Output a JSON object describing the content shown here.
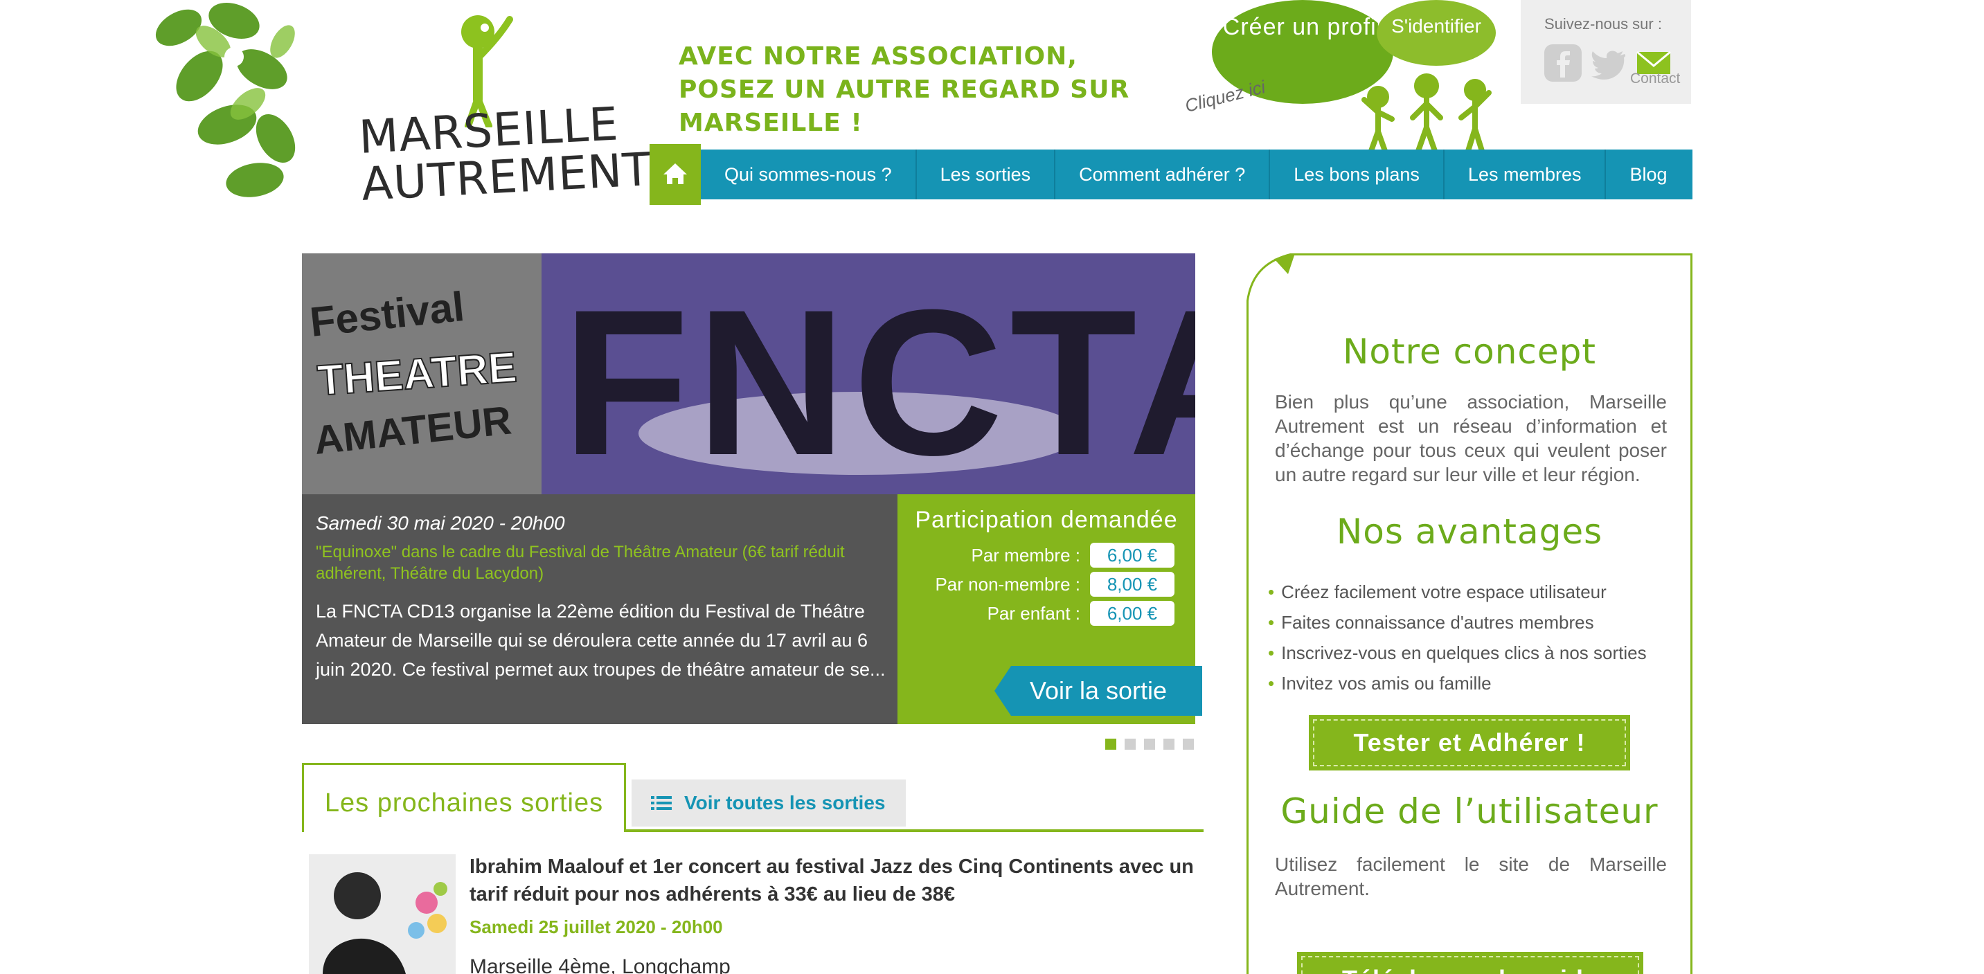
{
  "header": {
    "logo_line1": "MARSEILLE",
    "logo_line2": "AUTREMENT",
    "tagline_line1": "AVEC NOTRE ASSOCIATION,",
    "tagline_line2": "POSEZ UN AUTRE REGARD SUR MARSEILLE !",
    "create_profile": "Créer un profil",
    "login": "S'identifier",
    "click_here": "Cliquez ici",
    "follow_us": "Suivez-nous sur :",
    "contact": "Contact"
  },
  "nav": {
    "items": [
      {
        "label": "Qui sommes-nous ?"
      },
      {
        "label": "Les sorties"
      },
      {
        "label": "Comment adhérer ?"
      },
      {
        "label": "Les bons plans"
      },
      {
        "label": "Les membres"
      },
      {
        "label": "Blog"
      }
    ]
  },
  "slider": {
    "banner_title": "FNCTA",
    "poster_line1": "Festival",
    "poster_line2": "THEATRE",
    "poster_line3": "AMATEUR",
    "date": "Samedi 30 mai 2020 - 20h00",
    "subtitle": "\"Equinoxe\" dans le cadre du Festival de Théâtre Amateur (6€ tarif réduit adhérent, Théâtre du Lacydon)",
    "description": "La FNCTA CD13 organise la 22ème édition du Festival de Théâtre Amateur de Marseille qui se déroulera cette année du 17 avril au 6 juin 2020. Ce festival permet aux troupes de théâtre amateur de se...",
    "price_title": "Participation demandée",
    "prices": [
      {
        "label": "Par membre :",
        "value": "6,00 €"
      },
      {
        "label": "Par non-membre :",
        "value": "8,00 €"
      },
      {
        "label": "Par enfant :",
        "value": "6,00 €"
      }
    ],
    "cta": "Voir la sortie",
    "active_slide": 1,
    "slide_count": 5
  },
  "tabs": {
    "active": "Les prochaines sorties",
    "other": "Voir toutes les sorties"
  },
  "event": {
    "title": "Ibrahim Maalouf et 1er concert au festival Jazz des Cinq Continents avec un tarif réduit pour nos adhérents à 33€ au lieu de 38€",
    "date": "Samedi 25 juillet 2020 - 20h00",
    "location": "Marseille 4ème, Longchamp"
  },
  "sidebar": {
    "concept_title": "Notre concept",
    "concept_text": "Bien plus qu’une association, Marseille Autrement est un réseau d’information et d’échange pour tous ceux qui veulent poser un autre regard sur leur ville et leur région.",
    "advantages_title": "Nos avantages",
    "advantages": [
      "Créez facilement votre espace utilisateur",
      "Faites connaissance d'autres membres",
      "Inscrivez-vous en quelques clics à nos sorties",
      "Invitez vos amis ou famille"
    ],
    "test_button": "Tester et Adhérer !",
    "guide_title": "Guide de l’utilisateur",
    "guide_text": "Utilisez facilement le site de Marseille Autrement.",
    "download_button": "Télécharger le guide"
  },
  "colors": {
    "green": "#85b61c",
    "blue": "#1594b4",
    "dark_gray": "#555555"
  }
}
